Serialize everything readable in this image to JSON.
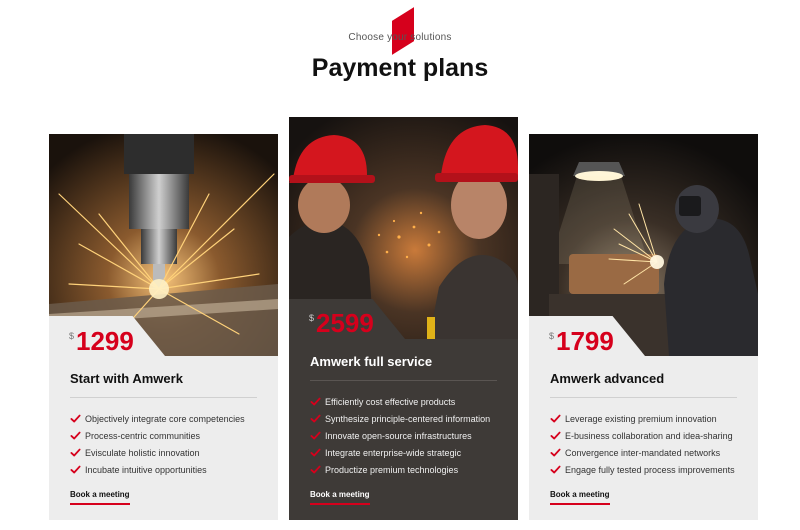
{
  "header": {
    "eyebrow": "Choose your solutions",
    "title": "Payment plans",
    "accent_color": "#d6001c"
  },
  "plans": [
    {
      "currency": "$",
      "price": "1299",
      "name": "Start with Amwerk",
      "features": [
        "Objectively integrate core competencies",
        "Process-centric communities",
        "Evisculate holistic innovation",
        "Incubate intuitive opportunities"
      ],
      "cta": "Book a meeting",
      "photo": "drilling-sparks-photo"
    },
    {
      "currency": "$",
      "price": "2599",
      "name": "Amwerk full service",
      "features": [
        "Efficiently cost effective products",
        "Synthesize principle-centered information",
        "Innovate open-source infrastructures",
        "Integrate enterprise-wide strategic",
        "Productize premium technologies"
      ],
      "cta": "Book a meeting",
      "photo": "workers-red-hardhats-photo",
      "highlighted": true
    },
    {
      "currency": "$",
      "price": "1799",
      "name": "Amwerk advanced",
      "features": [
        "Leverage existing premium innovation",
        "E-business collaboration and idea-sharing",
        "Convergence inter-mandated networks",
        "Engage fully tested process improvements"
      ],
      "cta": "Book a meeting",
      "photo": "welder-grinding-photo"
    }
  ],
  "icons": {
    "feature_check": "check-icon"
  },
  "colors": {
    "accent": "#d6001c",
    "dark_card": "#3e3a37",
    "light_card": "#ededed"
  }
}
